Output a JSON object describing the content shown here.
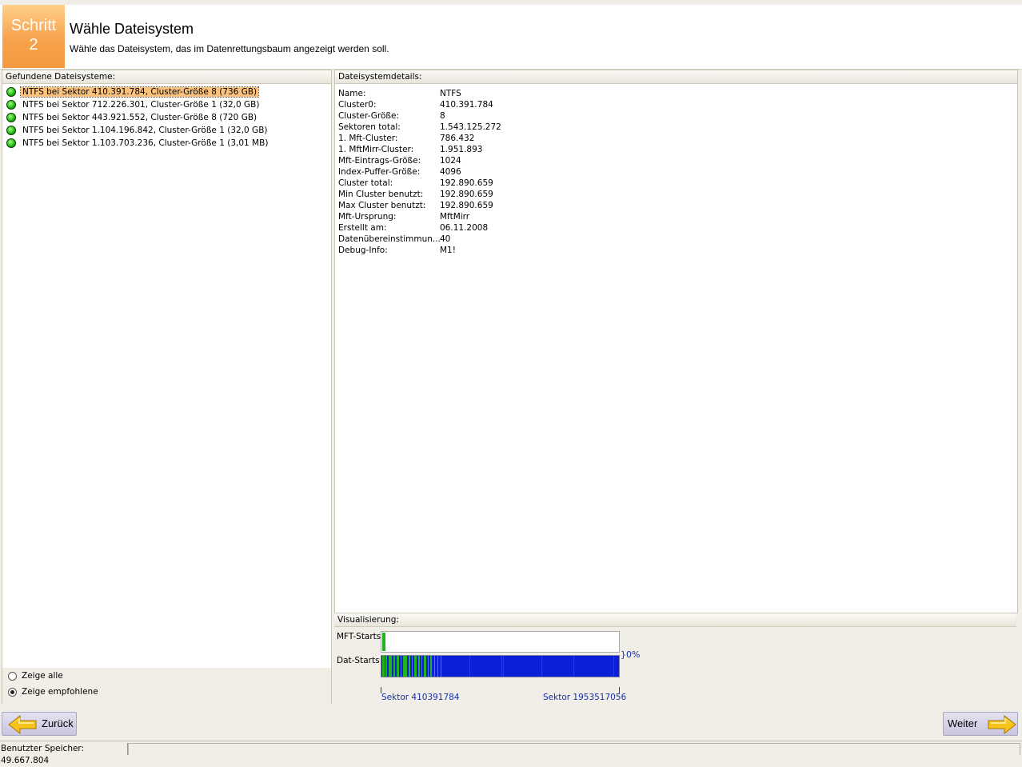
{
  "header": {
    "step_word": "Schritt",
    "step_number": "2",
    "title": "Wähle Dateisystem",
    "subtitle": "Wähle das Dateisystem, das im Datenrettungsbaum angezeigt werden soll."
  },
  "left_panel": {
    "title": "Gefundene Dateisysteme:",
    "items": [
      {
        "label": "NTFS bei Sektor 410.391.784, Cluster-Größe 8 (736 GB)"
      },
      {
        "label": "NTFS bei Sektor 712.226.301, Cluster-Größe 1 (32,0 GB)"
      },
      {
        "label": "NTFS bei Sektor 443.921.552, Cluster-Größe 8 (720 GB)"
      },
      {
        "label": "NTFS bei Sektor 1.104.196.842, Cluster-Größe 1 (32,0 GB)"
      },
      {
        "label": "NTFS bei Sektor 1.103.703.236, Cluster-Größe 1 (3,01 MB)"
      }
    ],
    "selected_index": 0,
    "radio_all": "Zeige alle",
    "radio_recommended": "Zeige empfohlene",
    "radio_selected": "recommended"
  },
  "details": {
    "title": "Dateisystemdetails:",
    "rows": [
      {
        "key": "Name:",
        "value": "NTFS"
      },
      {
        "key": "Cluster0:",
        "value": "410.391.784"
      },
      {
        "key": "Cluster-Größe:",
        "value": "8"
      },
      {
        "key": "Sektoren total:",
        "value": "1.543.125.272"
      },
      {
        "key": "1. Mft-Cluster:",
        "value": "786.432"
      },
      {
        "key": "1. MftMirr-Cluster:",
        "value": "1.951.893"
      },
      {
        "key": "Mft-Eintrags-Größe:",
        "value": "1024"
      },
      {
        "key": "Index-Puffer-Größe:",
        "value": "4096"
      },
      {
        "key": "Cluster total:",
        "value": "192.890.659"
      },
      {
        "key": "Min Cluster benutzt:",
        "value": "192.890.659"
      },
      {
        "key": "Max Cluster benutzt:",
        "value": "192.890.659"
      },
      {
        "key": "Mft-Ursprung:",
        "value": "MftMirr"
      },
      {
        "key": "Erstellt am:",
        "value": "06.11.2008"
      },
      {
        "key": "Datenübereinstimmun...",
        "value": "40"
      },
      {
        "key": "Debug-Info:",
        "value": "M1!"
      }
    ]
  },
  "visualization": {
    "title": "Visualisierung:",
    "mft_label": "MFT-Starts",
    "dat_label": "Dat-Starts",
    "percent": "}0%",
    "sector_start": "Sektor  410391784",
    "sector_end": "Sektor  1953517056",
    "colors": {
      "used": "#0b1fd6",
      "data": "#22b51b"
    }
  },
  "buttons": {
    "back": "Zurück",
    "next": "Weiter"
  },
  "status": {
    "memory": "Benutzter Speicher: 49.667.804"
  }
}
